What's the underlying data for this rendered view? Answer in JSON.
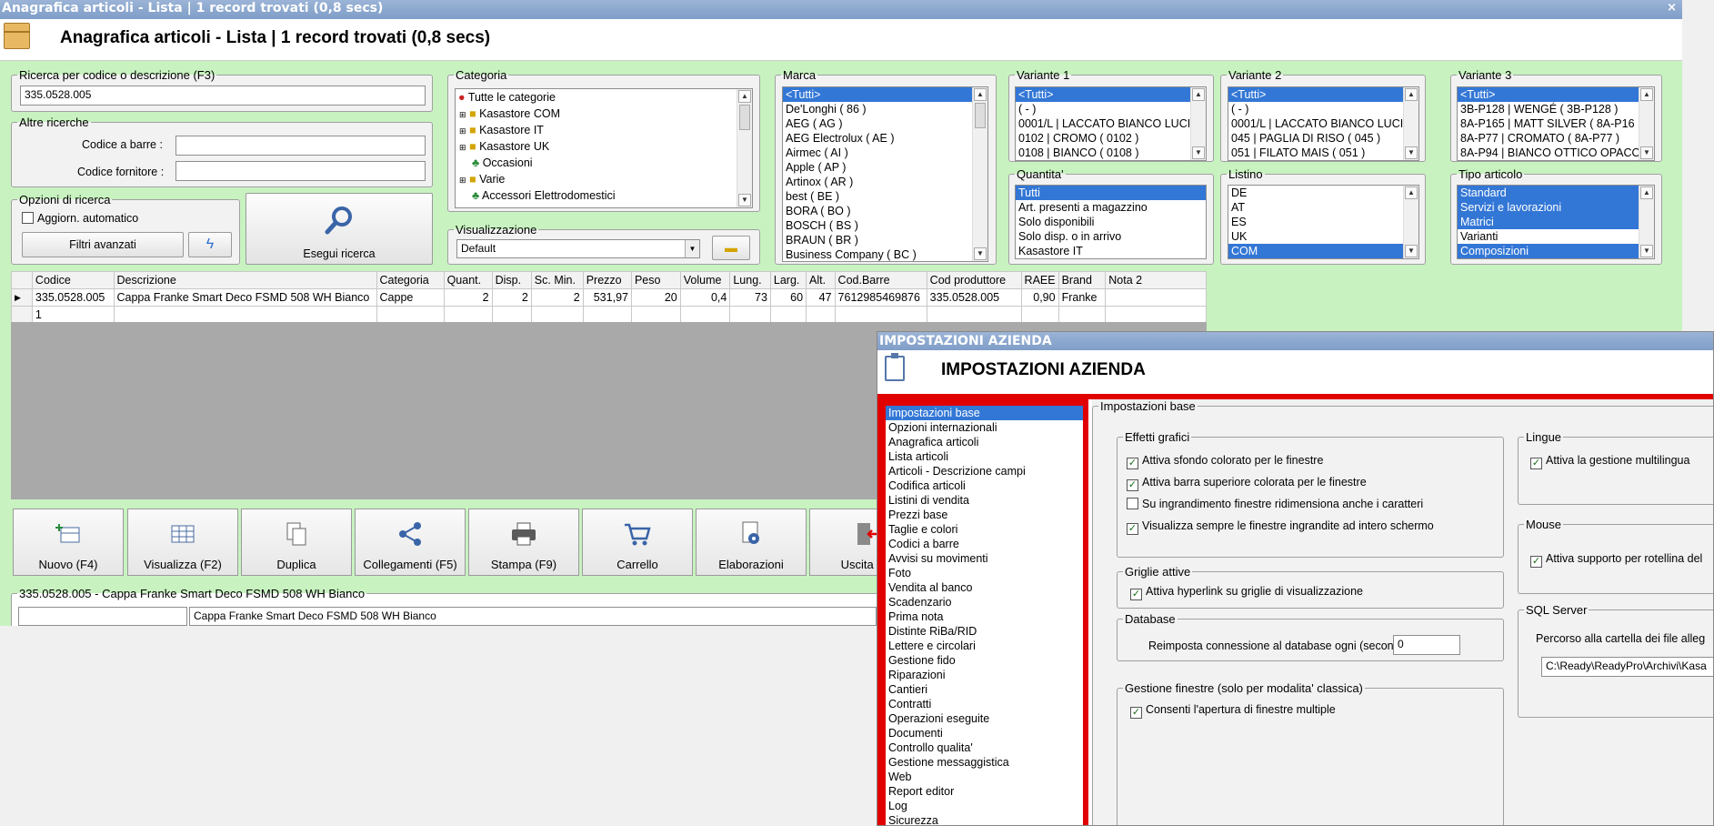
{
  "window": {
    "title": "Anagrafica articoli  - Lista | 1 record trovati (0,8 secs)",
    "header": "Anagrafica articoli  - Lista | 1 record trovati (0,8 secs)",
    "close": "×"
  },
  "search": {
    "legend": "Ricerca per codice o descrizione (F3)",
    "value": "335.0528.005"
  },
  "other": {
    "legend": "Altre ricerche",
    "barcode_label": "Codice a barre :",
    "supplier_label": "Codice fornitore :",
    "barcode_value": "",
    "supplier_value": ""
  },
  "options": {
    "legend": "Opzioni di ricerca",
    "auto_update": "Aggiorn. automatico",
    "advanced": "Filtri avanzati",
    "run": "Esegui ricerca"
  },
  "categoria": {
    "legend": "Categoria",
    "items": [
      "Tutte le categorie",
      "Kasastore COM",
      "Kasastore IT",
      "Kasastore UK",
      "Occasioni",
      "Varie",
      "Accessori Elettrodomestici"
    ]
  },
  "visualizzazione": {
    "legend": "Visualizzazione",
    "value": "Default"
  },
  "marca": {
    "legend": "Marca",
    "items": [
      "<Tutti>",
      "De'Longhi ( 86 )",
      "AEG ( AG )",
      "AEG Electrolux ( AE )",
      "Airmec ( AI )",
      "Apple ( AP )",
      "Artinox ( AR )",
      "best ( BE )",
      "BORA ( BO )",
      "BOSCH ( BS )",
      "BRAUN ( BR )",
      "Business Company ( BC )"
    ]
  },
  "variante1": {
    "legend": "Variante 1",
    "items": [
      "<Tutti>",
      "( - )",
      "0001/L | LACCATO BIANCO LUCI",
      "0102 | CROMO ( 0102 )",
      "0108 | BIANCO ( 0108 )"
    ]
  },
  "variante2": {
    "legend": "Variante 2",
    "items": [
      "<Tutti>",
      "( - )",
      "0001/L | LACCATO BIANCO LUCIDO",
      "045 | PAGLIA DI RISO ( 045 )",
      "051 | FILATO MAIS ( 051 )"
    ]
  },
  "variante3": {
    "legend": "Variante 3",
    "items": [
      "<Tutti>",
      "3B-P128 | WENGÉ ( 3B-P128 )",
      "8A-P165 | MATT SILVER ( 8A-P16",
      "8A-P77 | CROMATO ( 8A-P77 )",
      "8A-P94 | BIANCO OTTICO OPACO"
    ]
  },
  "quantita": {
    "legend": "Quantita'",
    "items": [
      "Tutti",
      "Art. presenti a magazzino",
      "Solo disponibili",
      "Solo disp. o in arrivo",
      "Kasastore IT"
    ]
  },
  "listino": {
    "legend": "Listino",
    "items": [
      "DE",
      "AT",
      "ES",
      "UK",
      "COM"
    ]
  },
  "tipo": {
    "legend": "Tipo articolo",
    "items": [
      "Standard",
      "Servizi e lavorazioni",
      "Matrici",
      "Varianti",
      "Composizioni"
    ]
  },
  "grid": {
    "headers": [
      "Codice",
      "Descrizione",
      "Categoria",
      "Quant.",
      "Disp.",
      "Sc. Min.",
      "Prezzo",
      "Peso",
      "Volume",
      "Lung.",
      "Larg.",
      "Alt.",
      "Cod.Barre",
      "Cod produttore",
      "RAEE",
      "Brand",
      "Nota 2"
    ],
    "row": [
      "335.0528.005",
      "Cappa Franke Smart Deco FSMD 508 WH Bianco",
      "Cappe",
      "2",
      "2",
      "2",
      "531,97",
      "20",
      "0,4",
      "73",
      "60",
      "47",
      "7612985469876",
      "335.0528.005",
      "0,90",
      "Franke",
      ""
    ],
    "count": "1"
  },
  "toolbar": [
    "Nuovo (F4)",
    "Visualizza (F2)",
    "Duplica",
    "Collegamenti (F5)",
    "Stampa (F9)",
    "Carrello",
    "Elaborazioni",
    "Uscita (E"
  ],
  "detail": {
    "legend": "335.0528.005 - Cappa Franke Smart Deco FSMD 508 WH Bianco",
    "value": "Cappa Franke Smart Deco FSMD 508 WH Bianco"
  },
  "dialog": {
    "title": "IMPOSTAZIONI AZIENDA",
    "header": "IMPOSTAZIONI AZIENDA",
    "menu": [
      "Impostazioni base",
      "Opzioni internazionali",
      "Anagrafica articoli",
      "Lista articoli",
      "Articoli - Descrizione campi",
      "Codifica articoli",
      "Listini di vendita",
      "Prezzi base",
      "Taglie e colori",
      "Codici a barre",
      "Avvisi su movimenti",
      "Foto",
      "Vendita al banco",
      "Scadenzario",
      "Prima nota",
      "Distinte RiBa/RID",
      "Lettere e circolari",
      "Gestione fido",
      "Riparazioni",
      "Cantieri",
      "Contratti",
      "Operazioni eseguite",
      "Documenti",
      "Controllo qualita'",
      "Gestione messaggistica",
      "Web",
      "Report editor",
      "Log",
      "Sicurezza"
    ],
    "panel": "Impostazioni base",
    "effetti": {
      "legend": "Effetti grafici",
      "items": [
        {
          "label": "Attiva sfondo colorato per le finestre",
          "checked": true
        },
        {
          "label": "Attiva barra superiore colorata per le finestre",
          "checked": true
        },
        {
          "label": "Su ingrandimento finestre ridimensiona anche i caratteri",
          "checked": false
        },
        {
          "label": "Visualizza sempre le finestre ingrandite ad intero schermo",
          "checked": true
        }
      ]
    },
    "griglie": {
      "legend": "Griglie attive",
      "label": "Attiva hyperlink su griglie di visualizzazione"
    },
    "database": {
      "legend": "Database",
      "label": "Reimposta connessione al database ogni (secondi) :",
      "value": "0"
    },
    "finestre": {
      "legend": "Gestione finestre (solo per modalita' classica)",
      "label": "Consenti l'apertura di finestre multiple"
    },
    "lingue": {
      "legend": "Lingue",
      "label": "Attiva la gestione multilingua"
    },
    "mouse": {
      "legend": "Mouse",
      "label": "Attiva supporto per rotellina del"
    },
    "sql": {
      "legend": "SQL Server",
      "label": "Percorso alla cartella dei file alleg",
      "value": "C:\\Ready\\ReadyPro\\Archivi\\Kasa"
    }
  }
}
